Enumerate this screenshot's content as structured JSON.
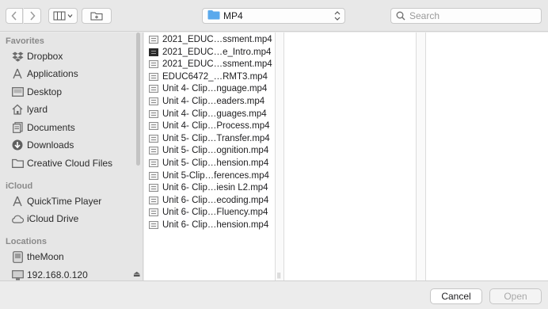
{
  "toolbar": {
    "path_label": "MP4",
    "search_placeholder": "Search"
  },
  "sidebar": {
    "favorites_heading": "Favorites",
    "favorites": [
      {
        "label": "Dropbox",
        "icon": "dropbox-icon"
      },
      {
        "label": "Applications",
        "icon": "applications-icon"
      },
      {
        "label": "Desktop",
        "icon": "desktop-icon"
      },
      {
        "label": "lyard",
        "icon": "home-icon"
      },
      {
        "label": "Documents",
        "icon": "documents-icon"
      },
      {
        "label": "Downloads",
        "icon": "downloads-icon"
      },
      {
        "label": "Creative Cloud Files",
        "icon": "folder-icon"
      }
    ],
    "icloud_heading": "iCloud",
    "icloud": [
      {
        "label": "QuickTime Player",
        "icon": "quicktime-icon"
      },
      {
        "label": "iCloud Drive",
        "icon": "cloud-icon"
      }
    ],
    "locations_heading": "Locations",
    "locations": [
      {
        "label": "theMoon",
        "icon": "computer-icon"
      },
      {
        "label": "192.168.0.120",
        "icon": "display-icon"
      }
    ]
  },
  "files": [
    {
      "name": "2021_EDUC…ssment.mp4",
      "dark": false
    },
    {
      "name": "2021_EDUC…e_Intro.mp4",
      "dark": true
    },
    {
      "name": "2021_EDUC…ssment.mp4",
      "dark": false
    },
    {
      "name": "EDUC6472_…RMT3.mp4",
      "dark": false
    },
    {
      "name": "Unit 4- Clip…nguage.mp4",
      "dark": false
    },
    {
      "name": "Unit 4- Clip…eaders.mp4",
      "dark": false
    },
    {
      "name": "Unit 4- Clip…guages.mp4",
      "dark": false
    },
    {
      "name": "Unit 4- Clip…Process.mp4",
      "dark": false
    },
    {
      "name": "Unit 5- Clip…Transfer.mp4",
      "dark": false
    },
    {
      "name": "Unit 5- Clip…ognition.mp4",
      "dark": false
    },
    {
      "name": "Unit 5- Clip…hension.mp4",
      "dark": false
    },
    {
      "name": "Unit 5-Clip…ferences.mp4",
      "dark": false
    },
    {
      "name": "Unit 6- Clip…iesin L2.mp4",
      "dark": false
    },
    {
      "name": "Unit 6- Clip…ecoding.mp4",
      "dark": false
    },
    {
      "name": "Unit 6- Clip…Fluency.mp4",
      "dark": false
    },
    {
      "name": "Unit 6- Clip…hension.mp4",
      "dark": false
    }
  ],
  "footer": {
    "cancel_label": "Cancel",
    "open_label": "Open"
  }
}
